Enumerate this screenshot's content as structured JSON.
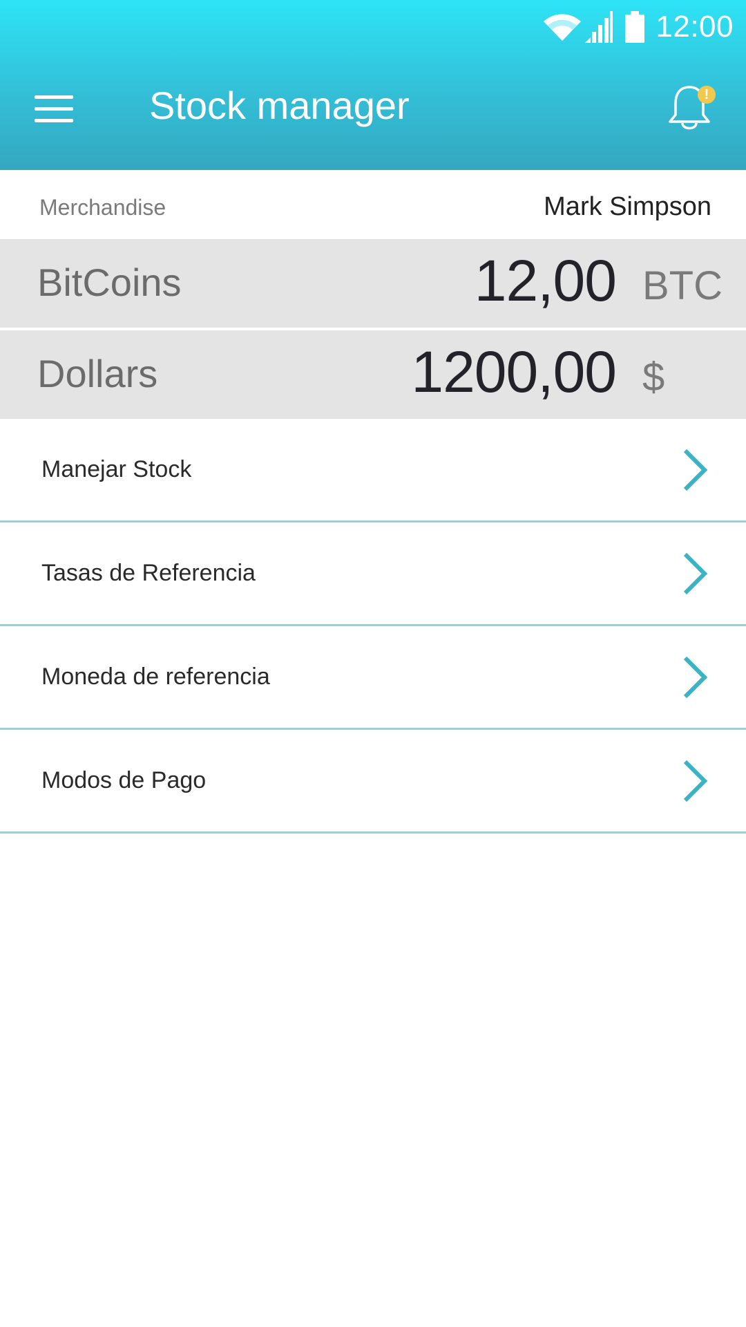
{
  "status_bar": {
    "time": "12:00",
    "icons": [
      "wifi-icon",
      "signal-icon",
      "battery-icon"
    ]
  },
  "toolbar": {
    "title": "Stock manager",
    "menu_icon": "hamburger-menu-icon",
    "notification_icon": "bell-icon",
    "notification_badge": "!"
  },
  "merchant": {
    "label": "Merchandise",
    "user": "Mark Simpson"
  },
  "balances": [
    {
      "name": "BitCoins",
      "amount": "12,00",
      "unit": "BTC"
    },
    {
      "name": "Dollars",
      "amount": "1200,00",
      "unit": "$"
    }
  ],
  "menu": {
    "items": [
      {
        "label": "Manejar Stock"
      },
      {
        "label": "Tasas de Referencia"
      },
      {
        "label": "Moneda de referencia"
      },
      {
        "label": "Modos de Pago"
      }
    ],
    "chevron_icon": "chevron-right-icon"
  },
  "colors": {
    "header_gradient_top": "#2ee3f6",
    "header_gradient_bottom": "#34a7c0",
    "accent": "#3ab3c4",
    "divider": "#8dd5dc",
    "badge": "#f2c94c",
    "balance_bg": "#e4e4e4"
  }
}
